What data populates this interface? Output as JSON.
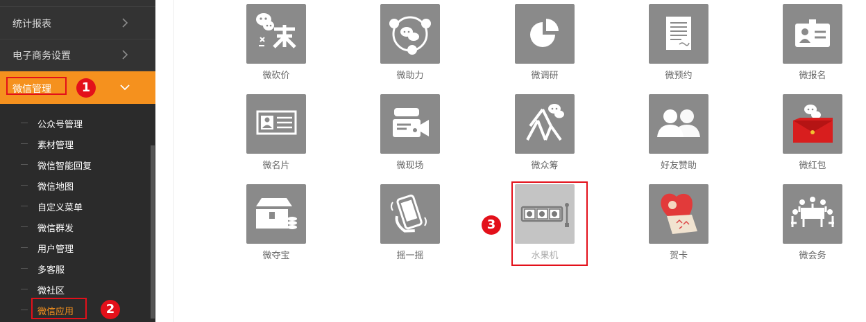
{
  "sidebar": {
    "nav": [
      {
        "label": "统计报表",
        "state": "collapsed"
      },
      {
        "label": "电子商务设置",
        "state": "collapsed"
      },
      {
        "label": "微信管理",
        "state": "expanded"
      }
    ],
    "submenu": [
      {
        "label": "公众号管理"
      },
      {
        "label": "素材管理"
      },
      {
        "label": "微信智能回复"
      },
      {
        "label": "微信地图"
      },
      {
        "label": "自定义菜单"
      },
      {
        "label": "微信群发"
      },
      {
        "label": "用户管理"
      },
      {
        "label": "多客服"
      },
      {
        "label": "微社区"
      },
      {
        "label": "微信应用",
        "current": true
      }
    ]
  },
  "annotations": {
    "step1": "1",
    "step2": "2",
    "step3": "3"
  },
  "apps": [
    {
      "label": "微砍价",
      "icon": "bargain-chat-icon"
    },
    {
      "label": "微助力",
      "icon": "assist-circle-icon"
    },
    {
      "label": "微调研",
      "icon": "pie-chart-icon"
    },
    {
      "label": "微预约",
      "icon": "document-icon"
    },
    {
      "label": "微报名",
      "icon": "id-badge-icon"
    },
    {
      "label": "微名片",
      "icon": "business-card-icon"
    },
    {
      "label": "微现场",
      "icon": "video-camera-icon"
    },
    {
      "label": "微众筹",
      "icon": "crowd-icon"
    },
    {
      "label": "好友赞助",
      "icon": "friends-icon"
    },
    {
      "label": "微红包",
      "icon": "red-envelope-icon"
    },
    {
      "label": "微夺宝",
      "icon": "treasure-chest-icon"
    },
    {
      "label": "摇一摇",
      "icon": "shake-phone-icon"
    },
    {
      "label": "水果机",
      "icon": "slot-machine-icon",
      "disabled": true
    },
    {
      "label": "贺卡",
      "icon": "greeting-card-icon"
    },
    {
      "label": "微会务",
      "icon": "meeting-icon"
    }
  ],
  "colors": {
    "accent": "#f5911e",
    "sidebar": "#333333",
    "submenu": "#2b2b2b",
    "tile": "#8a8a8a",
    "annotation": "#e3101a"
  }
}
